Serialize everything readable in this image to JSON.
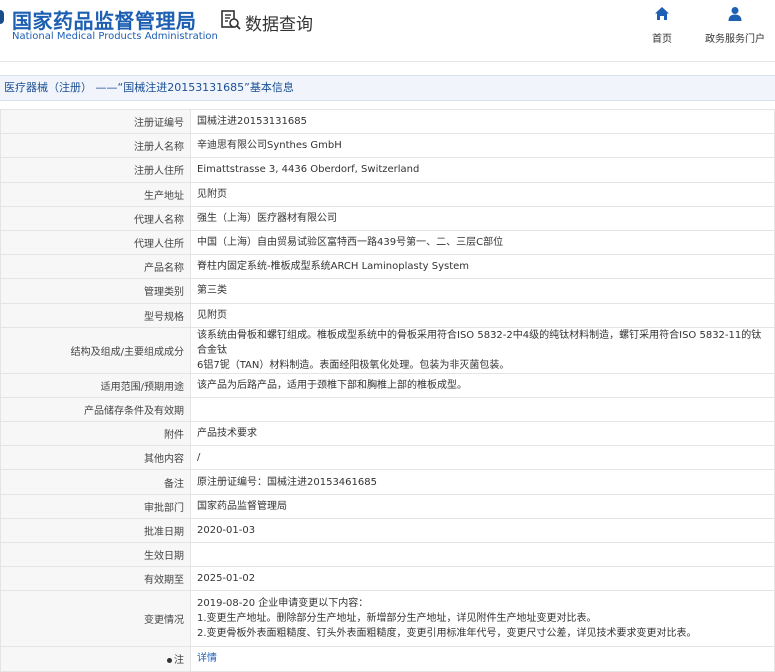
{
  "header": {
    "brand_cn": "国家药品监督管理局",
    "brand_en": "National Medical Products Administration",
    "query_title": "数据查询",
    "nav": [
      {
        "label": "首页",
        "icon": "home-icon"
      },
      {
        "label": "政务服务门户",
        "icon": "user-icon"
      }
    ]
  },
  "page_title": "医疗器械（注册） ——“国械注进20153131685”基本信息",
  "rows": [
    {
      "key": "注册证编号",
      "value": "国械注进20153131685"
    },
    {
      "key": "注册人名称",
      "value": "辛迪思有限公司Synthes GmbH"
    },
    {
      "key": "注册人住所",
      "value": "Eimattstrasse 3, 4436 Oberdorf, Switzerland"
    },
    {
      "key": "生产地址",
      "value": "见附页"
    },
    {
      "key": "代理人名称",
      "value": "强生（上海）医疗器材有限公司"
    },
    {
      "key": "代理人住所",
      "value": "中国（上海）自由贸易试验区富特西一路439号第一、二、三层C部位"
    },
    {
      "key": "产品名称",
      "value": "脊柱内固定系统-椎板成型系统ARCH Laminoplasty System"
    },
    {
      "key": "管理类别",
      "value": "第三类"
    },
    {
      "key": "型号规格",
      "value": "见附页"
    },
    {
      "key": "结构及组成/主要组成成分",
      "value_lines": [
        "该系统由骨板和螺钉组成。椎板成型系统中的骨板采用符合ISO 5832-2中4级的纯钛材料制造，螺钉采用符合ISO 5832-11的钛合金钛",
        "6铝7铌（TAN）材料制造。表面经阳极氧化处理。包装为非灭菌包装。"
      ]
    },
    {
      "key": "适用范围/预期用途",
      "value": "该产品为后路产品，适用于颈椎下部和胸椎上部的椎板成型。"
    },
    {
      "key": "产品储存条件及有效期",
      "value": ""
    },
    {
      "key": "附件",
      "value": "产品技术要求"
    },
    {
      "key": "其他内容",
      "value": "/"
    },
    {
      "key": "备注",
      "value": "原注册证编号：国械注进20153461685"
    },
    {
      "key": "审批部门",
      "value": "国家药品监督管理局"
    },
    {
      "key": "批准日期",
      "value": "2020-01-03"
    },
    {
      "key": "生效日期",
      "value": ""
    },
    {
      "key": "有效期至",
      "value": "2025-01-02"
    },
    {
      "key": "变更情况",
      "value_lines": [
        "2019-08-20 企业申请变更以下内容：",
        "1.变更生产地址。删除部分生产地址，新增部分生产地址，详见附件生产地址变更对比表。",
        "2.变更骨板外表面粗糙度、钉头外表面粗糙度，变更引用标准年代号，变更尺寸公差，详见技术要求变更对比表。"
      ]
    },
    {
      "key": "注",
      "value": "详情"
    }
  ]
}
